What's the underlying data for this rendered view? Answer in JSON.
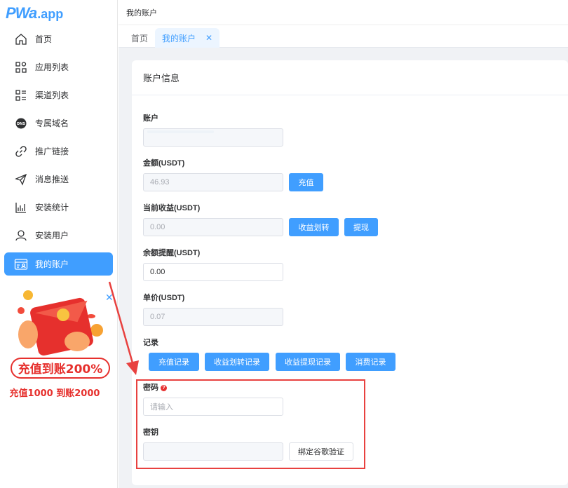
{
  "logo": {
    "main": "PWa",
    "sub": ".app"
  },
  "sidebar": {
    "items": [
      {
        "label": "首页",
        "icon": "home-icon"
      },
      {
        "label": "应用列表",
        "icon": "apps-icon"
      },
      {
        "label": "渠道列表",
        "icon": "channel-list-icon"
      },
      {
        "label": "专属域名",
        "icon": "dns-icon"
      },
      {
        "label": "推广链接",
        "icon": "link-icon"
      },
      {
        "label": "消息推送",
        "icon": "send-icon"
      },
      {
        "label": "安装统计",
        "icon": "stats-icon"
      },
      {
        "label": "安装用户",
        "icon": "user-icon"
      },
      {
        "label": "我的账户",
        "icon": "account-card-icon"
      }
    ],
    "active_index": 8
  },
  "promo": {
    "line1": "充值到账200%",
    "line2": "充值1000 到账2000"
  },
  "breadcrumb": "我的账户",
  "tabs": {
    "home": "首页",
    "active": "我的账户"
  },
  "card": {
    "title": "账户信息",
    "fields": {
      "account_label": "账户",
      "account_value": "",
      "amount_label": "金额(USDT)",
      "amount_value": "46.93",
      "recharge_btn": "充值",
      "earnings_label": "当前收益(USDT)",
      "earnings_value": "0.00",
      "transfer_btn": "收益划转",
      "withdraw_btn": "提现",
      "alert_label": "余额提醒(USDT)",
      "alert_value": "0.00",
      "price_label": "单价(USDT)",
      "price_value": "0.07",
      "records_label": "记录",
      "records": [
        "充值记录",
        "收益划转记录",
        "收益提现记录",
        "消费记录"
      ],
      "password_label": "密码",
      "password_placeholder": "请输入",
      "secret_label": "密钥",
      "bind_btn": "绑定谷歌验证"
    }
  },
  "colors": {
    "primary": "#409eff",
    "annotation_red": "#e8413f"
  }
}
